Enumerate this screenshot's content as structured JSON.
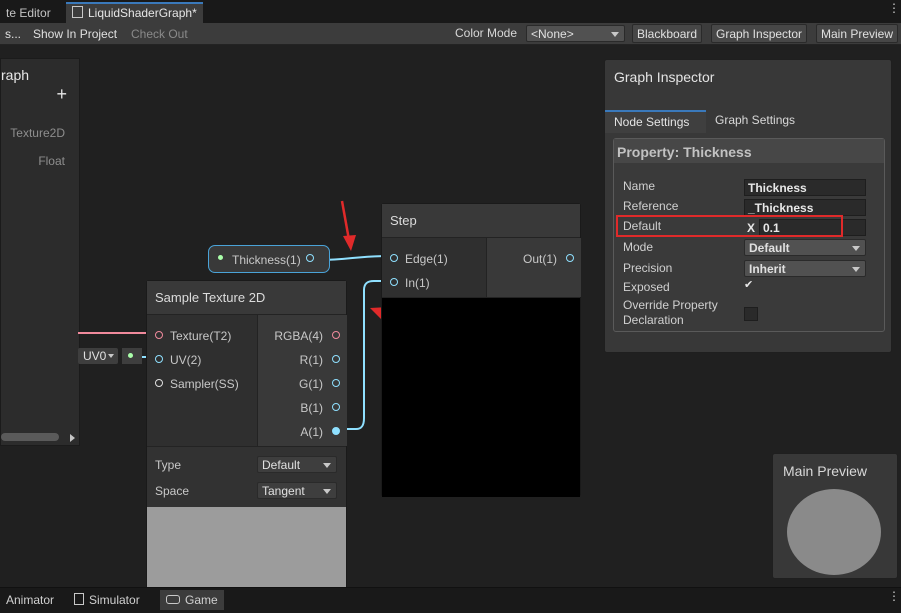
{
  "tabs": [
    {
      "label": "te Editor"
    },
    {
      "label": "LiquidShaderGraph*"
    }
  ],
  "toolbar": {
    "save_partial": "s...",
    "show_in_project": "Show In Project",
    "check_out": "Check Out",
    "color_mode_label": "Color Mode",
    "color_mode_value": "<None>",
    "blackboard": "Blackboard",
    "graph_inspector": "Graph Inspector",
    "main_preview": "Main Preview"
  },
  "blackboard": {
    "title": "raph",
    "add": "+",
    "properties": [
      {
        "type": "Texture2D"
      },
      {
        "type": "Float"
      }
    ]
  },
  "property_node": {
    "label": "Thickness(1)"
  },
  "uv_node": {
    "value": "UV0"
  },
  "step_node": {
    "title": "Step",
    "inputs": [
      "Edge(1)",
      "In(1)"
    ],
    "output": "Out(1)"
  },
  "sample_node": {
    "title": "Sample Texture 2D",
    "inputs": [
      "Texture(T2)",
      "UV(2)",
      "Sampler(SS)"
    ],
    "outputs": [
      "RGBA(4)",
      "R(1)",
      "G(1)",
      "B(1)",
      "A(1)"
    ],
    "type_label": "Type",
    "type_value": "Default",
    "space_label": "Space",
    "space_value": "Tangent"
  },
  "inspector": {
    "title": "Graph Inspector",
    "tabs": [
      "Node Settings",
      "Graph Settings"
    ],
    "property_header": "Property: Thickness",
    "fields": {
      "name_label": "Name",
      "name_value": "Thickness",
      "reference_label": "Reference",
      "reference_value": "_Thickness",
      "default_label": "Default",
      "default_axis": "X",
      "default_value": "0.1",
      "mode_label": "Mode",
      "mode_value": "Default",
      "precision_label": "Precision",
      "precision_value": "Inherit",
      "exposed_label": "Exposed",
      "exposed_check": "✔",
      "override_label_1": "Override Property",
      "override_label_2": "Declaration"
    }
  },
  "main_preview": {
    "title": "Main Preview"
  },
  "bottom_tabs": [
    {
      "label": "Animator"
    },
    {
      "label": "Simulator"
    },
    {
      "label": "Game"
    }
  ],
  "colors": {
    "accent": "#3a79bb",
    "float_wire": "#8fe0ff",
    "texture_wire": "#f08a9c",
    "annotation": "#e02a2a"
  }
}
